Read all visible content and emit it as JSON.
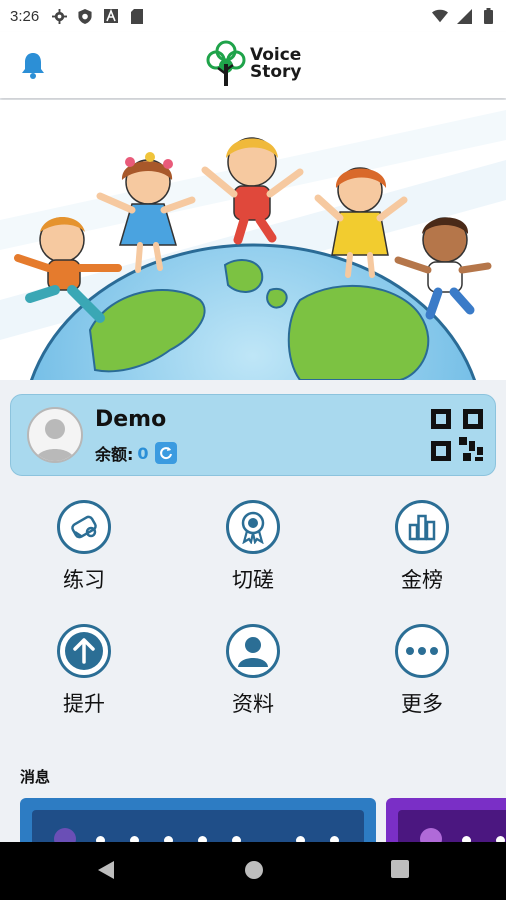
{
  "status_bar": {
    "time": "3:26",
    "left_icons": [
      "gear-icon",
      "shield-icon",
      "font-a-icon",
      "sd-card-icon"
    ],
    "right_icons": [
      "wifi-icon",
      "signal-icon",
      "battery-icon"
    ]
  },
  "header": {
    "logo_line1": "Voice",
    "logo_line2": "Story",
    "bell_icon": "bell-icon"
  },
  "profile": {
    "name": "Demo",
    "balance_label": "余额:",
    "balance_value": "0"
  },
  "menu": [
    {
      "label": "练习",
      "icon": "diploma-icon"
    },
    {
      "label": "切磋",
      "icon": "award-ribbon-icon"
    },
    {
      "label": "金榜",
      "icon": "bar-chart-icon"
    },
    {
      "label": "提升",
      "icon": "arrow-up-icon"
    },
    {
      "label": "资料",
      "icon": "person-icon"
    },
    {
      "label": "更多",
      "icon": "more-dots-icon"
    }
  ],
  "messages_title": "消息",
  "colors": {
    "accent_blue": "#2b6e95",
    "card_bg": "#a9d9ee",
    "balance_blue": "#2a8fd7",
    "message_card_blue": "#2d7cc3",
    "message_card_purple": "#7a2fc6"
  }
}
